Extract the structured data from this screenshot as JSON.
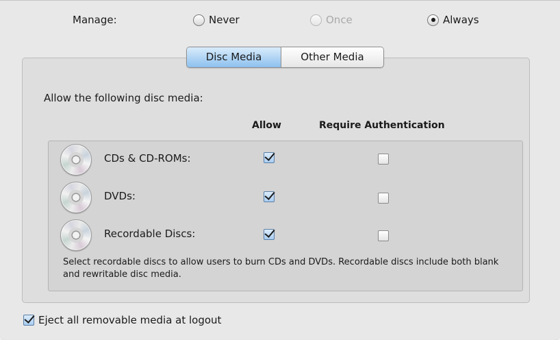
{
  "manage": {
    "label": "Manage:",
    "options": [
      {
        "label": "Never",
        "selected": false,
        "enabled": true
      },
      {
        "label": "Once",
        "selected": false,
        "enabled": false
      },
      {
        "label": "Always",
        "selected": true,
        "enabled": true
      }
    ]
  },
  "tabs": [
    {
      "label": "Disc Media",
      "active": true
    },
    {
      "label": "Other Media",
      "active": false
    }
  ],
  "disc_media": {
    "heading": "Allow the following disc media:",
    "columns": {
      "allow": "Allow",
      "auth": "Require Authentication"
    },
    "rows": [
      {
        "label": "CDs & CD-ROMs:",
        "allow": true,
        "require_auth": false,
        "icon": "disc-icon"
      },
      {
        "label": "DVDs:",
        "allow": true,
        "require_auth": false,
        "icon": "disc-icon"
      },
      {
        "label": "Recordable Discs:",
        "allow": true,
        "require_auth": false,
        "icon": "disc-icon"
      }
    ],
    "note": "Select recordable discs to allow users to burn CDs and DVDs. Recordable discs include both blank and rewritable disc media."
  },
  "eject": {
    "label": "Eject all removable media at logout",
    "checked": true
  },
  "colors": {
    "tab_active": "#8dc0ee",
    "panel": "#e8e8e8"
  }
}
